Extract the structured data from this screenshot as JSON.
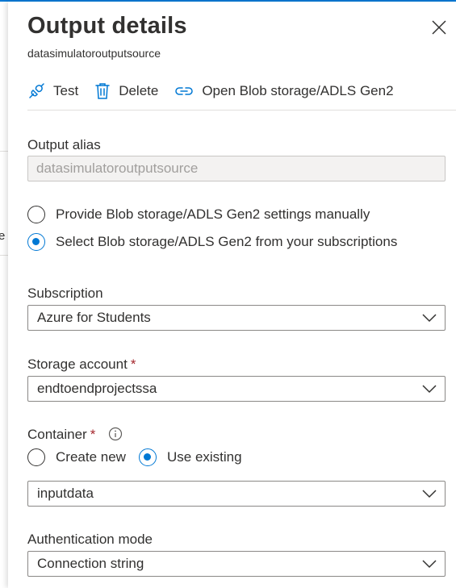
{
  "background": {
    "partial_text": "e"
  },
  "header": {
    "title": "Output details",
    "subtitle": "datasimulatoroutputsource"
  },
  "toolbar": {
    "test_label": "Test",
    "delete_label": "Delete",
    "open_label": "Open Blob storage/ADLS Gen2"
  },
  "output_alias": {
    "label": "Output alias",
    "value": "datasimulatoroutputsource"
  },
  "source_mode": {
    "options": [
      {
        "label": "Provide Blob storage/ADLS Gen2 settings manually",
        "selected": false
      },
      {
        "label": "Select Blob storage/ADLS Gen2 from your subscriptions",
        "selected": true
      }
    ]
  },
  "subscription": {
    "label": "Subscription",
    "value": "Azure for Students"
  },
  "storage_account": {
    "label": "Storage account",
    "required_mark": "*",
    "value": "endtoendprojectssa"
  },
  "container": {
    "label": "Container",
    "required_mark": "*",
    "options": [
      {
        "label": "Create new",
        "selected": false
      },
      {
        "label": "Use existing",
        "selected": true
      }
    ],
    "value": "inputdata"
  },
  "authentication": {
    "label": "Authentication mode",
    "value": "Connection string"
  },
  "colors": {
    "accent": "#0078d4",
    "required": "#a4262c",
    "text": "#323130",
    "disabled_bg": "#f3f2f1"
  }
}
